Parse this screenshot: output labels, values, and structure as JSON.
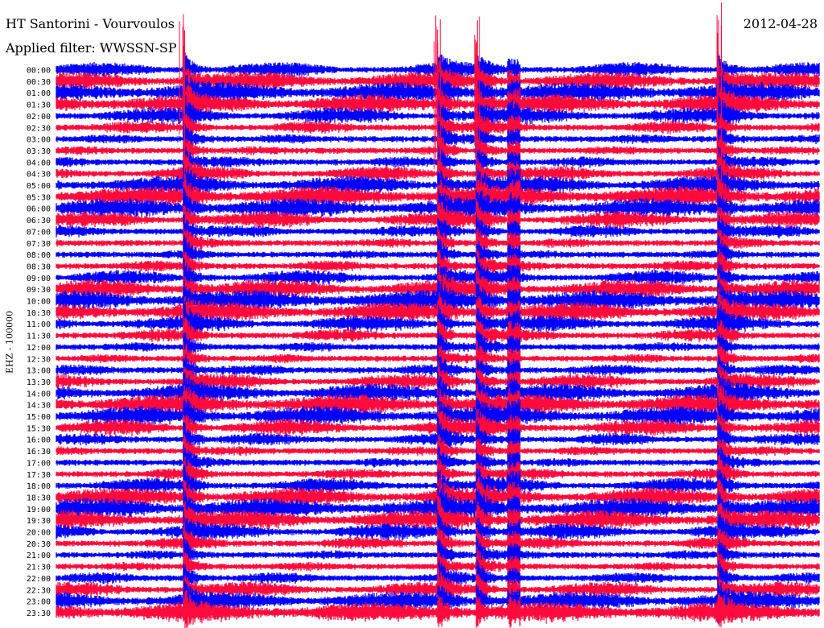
{
  "header": {
    "station": "HT Santorini - Vourvoulos",
    "filter": "Applied filter: WWSSN-SP",
    "date": "2012-04-28"
  },
  "channel_label": "EHZ - 100000",
  "colors": {
    "trace_a": "#0000ff",
    "trace_b": "#ff0a3c",
    "background": "#ffffff",
    "text": "#000000"
  },
  "chart_data": {
    "type": "line",
    "title": "HT Santorini - Vourvoulos",
    "subtitle": "Applied filter: WWSSN-SP",
    "date": "2012-04-28",
    "ylabel": "EHZ - 100000",
    "xlabel": "",
    "legend": "none",
    "grid": false,
    "row_labels": [
      "00:00",
      "00:30",
      "01:00",
      "01:30",
      "02:00",
      "02:30",
      "03:00",
      "03:30",
      "04:00",
      "04:30",
      "05:00",
      "05:30",
      "06:00",
      "06:30",
      "07:00",
      "07:30",
      "08:00",
      "08:30",
      "09:00",
      "09:30",
      "10:00",
      "10:30",
      "11:00",
      "11:30",
      "12:00",
      "12:30",
      "13:00",
      "13:30",
      "14:00",
      "14:30",
      "15:00",
      "15:30",
      "16:00",
      "16:30",
      "17:00",
      "17:30",
      "18:00",
      "18:30",
      "19:00",
      "19:30",
      "20:00",
      "20:30",
      "21:00",
      "21:30",
      "22:00",
      "22:30",
      "23:00",
      "23:30"
    ],
    "row_colors": [
      "trace_a",
      "trace_b"
    ],
    "minutes_per_row": 30,
    "events": [
      {
        "time_min": 5
      },
      {
        "time_min": 15
      },
      {
        "time_min": 16.5
      },
      {
        "time_min": 26
      }
    ],
    "gaps": [
      {
        "time_min": 18
      }
    ]
  }
}
